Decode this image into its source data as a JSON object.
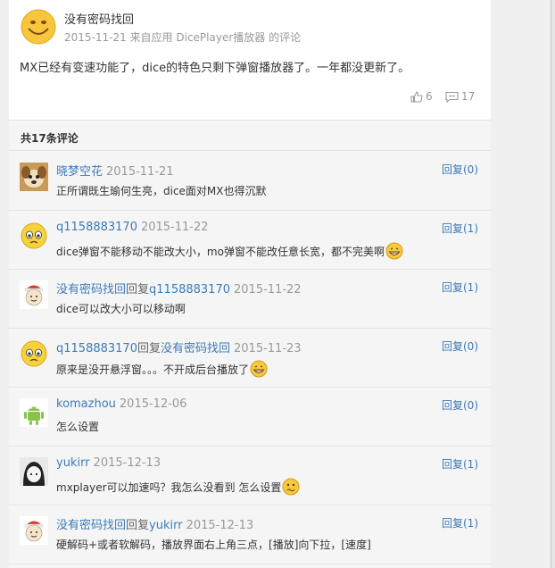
{
  "post": {
    "author": "没有密码找回",
    "meta": "2015-11-21 来自应用 DicePlayer播放器 的评论",
    "body": "MX已经有变速功能了，dice的特色只剩下弹窗播放器了。一年都没更新了。",
    "likes": "6",
    "comments": "17"
  },
  "comments_header": "共17条评论",
  "comments": [
    {
      "user": "晓梦空花",
      "reply_label": "",
      "reply_to": "",
      "time": "2015-11-21",
      "text": "正所谓既生瑜何生亮，dice面对MX也得沉默",
      "reply": "回复(0)",
      "avatar": "dog-avatar",
      "emoji": ""
    },
    {
      "user": "q1158883170",
      "reply_label": "",
      "reply_to": "",
      "time": "2015-11-22",
      "text": "dice弹窗不能移动不能改大小，mo弹窗不能改任意长宽，都不完美啊",
      "reply": "回复(1)",
      "avatar": "emoji-avatar",
      "emoji": "grin"
    },
    {
      "user": "没有密码找回",
      "reply_label": "回复",
      "reply_to": "q1158883170",
      "time": "2015-11-22",
      "text": "dice可以改大小可以移动啊",
      "reply": "回复(1)",
      "avatar": "santa-avatar",
      "emoji": ""
    },
    {
      "user": "q1158883170",
      "reply_label": "回复",
      "reply_to": "没有密码找回",
      "time": "2015-11-23",
      "text": "原来是没开悬浮窗。。。不开成后台播放了",
      "reply": "回复(0)",
      "avatar": "emoji-avatar",
      "emoji": "grin"
    },
    {
      "user": "komazhou",
      "reply_label": "",
      "reply_to": "",
      "time": "2015-12-06",
      "text": "怎么设置",
      "reply": "回复(0)",
      "avatar": "android-avatar",
      "emoji": ""
    },
    {
      "user": "yukirr",
      "reply_label": "",
      "reply_to": "",
      "time": "2015-12-13",
      "text": "mxplayer可以加速吗？我怎么没看到 怎么设置",
      "reply": "回复(1)",
      "avatar": "anime-avatar",
      "emoji": "confused"
    },
    {
      "user": "没有密码找回",
      "reply_label": "回复",
      "reply_to": "yukirr",
      "time": "2015-12-13",
      "text": "硬解码+或者软解码，播放界面右上角三点，[播放]向下拉，[速度]",
      "reply": "回复(1)",
      "avatar": "santa-avatar",
      "emoji": ""
    }
  ],
  "colors": {
    "link": "#3c7ab8",
    "meta": "#999999",
    "panel": "#f5f5f5"
  }
}
